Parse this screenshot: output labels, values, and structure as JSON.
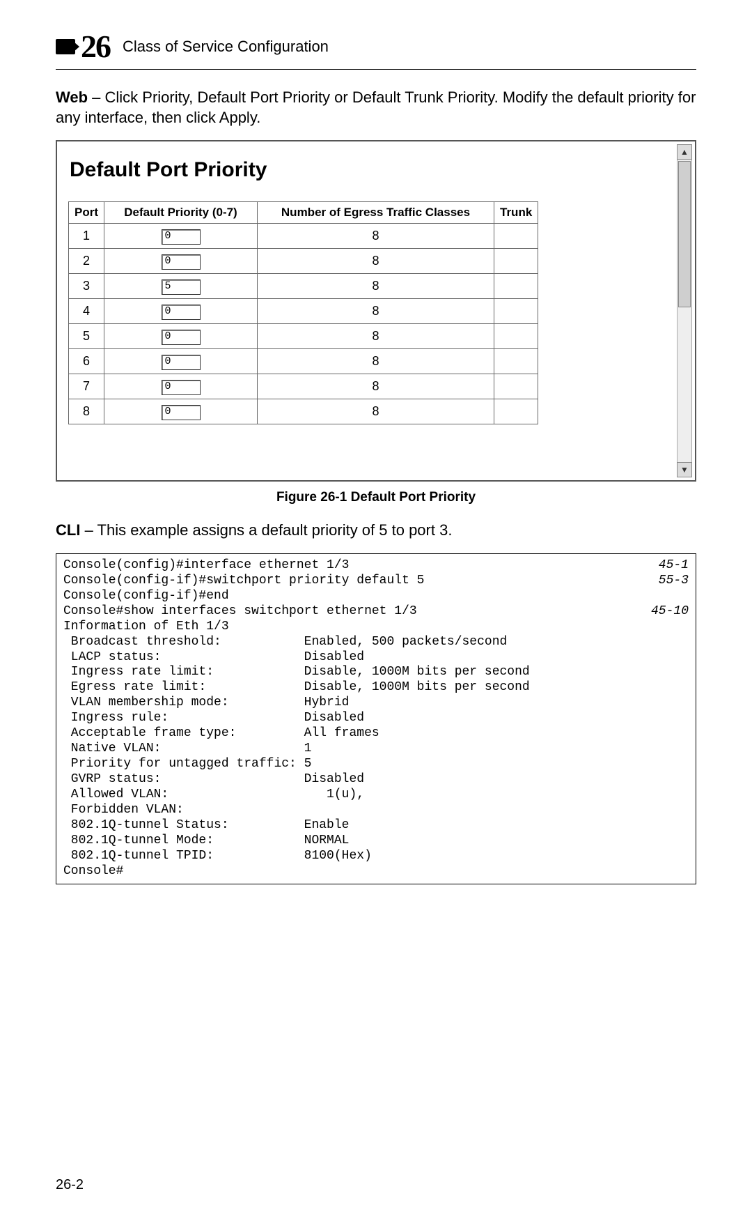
{
  "chapter": {
    "number": "26",
    "title": "Class of Service Configuration"
  },
  "intro": {
    "prefix": "Web",
    "text": " – Click Priority, Default Port Priority or Default Trunk Priority. Modify the default priority for any interface, then click Apply."
  },
  "panel": {
    "title": "Default Port Priority",
    "columns": [
      "Port",
      "Default Priority (0-7)",
      "Number of Egress Traffic Classes",
      "Trunk"
    ],
    "rows": [
      {
        "port": "1",
        "prio": "0",
        "classes": "8",
        "trunk": ""
      },
      {
        "port": "2",
        "prio": "0",
        "classes": "8",
        "trunk": ""
      },
      {
        "port": "3",
        "prio": "5",
        "classes": "8",
        "trunk": ""
      },
      {
        "port": "4",
        "prio": "0",
        "classes": "8",
        "trunk": ""
      },
      {
        "port": "5",
        "prio": "0",
        "classes": "8",
        "trunk": ""
      },
      {
        "port": "6",
        "prio": "0",
        "classes": "8",
        "trunk": ""
      },
      {
        "port": "7",
        "prio": "0",
        "classes": "8",
        "trunk": ""
      },
      {
        "port": "8",
        "prio": "0",
        "classes": "8",
        "trunk": ""
      }
    ]
  },
  "figure_caption": "Figure 26-1  Default Port Priority",
  "cli_intro": {
    "prefix": "CLI",
    "text": " – This example assigns a default priority of 5 to port 3."
  },
  "cli": {
    "lines": [
      {
        "t": "Console(config)#interface ethernet 1/3",
        "ref": "45-1"
      },
      {
        "t": "Console(config-if)#switchport priority default 5",
        "ref": "55-3"
      },
      {
        "t": "Console(config-if)#end",
        "ref": ""
      },
      {
        "t": "Console#show interfaces switchport ethernet 1/3",
        "ref": "45-10"
      },
      {
        "t": "Information of Eth 1/3",
        "ref": ""
      },
      {
        "t": " Broadcast threshold:           Enabled, 500 packets/second",
        "ref": ""
      },
      {
        "t": " LACP status:                   Disabled",
        "ref": ""
      },
      {
        "t": " Ingress rate limit:            Disable, 1000M bits per second",
        "ref": ""
      },
      {
        "t": " Egress rate limit:             Disable, 1000M bits per second",
        "ref": ""
      },
      {
        "t": " VLAN membership mode:          Hybrid",
        "ref": ""
      },
      {
        "t": " Ingress rule:                  Disabled",
        "ref": ""
      },
      {
        "t": " Acceptable frame type:         All frames",
        "ref": ""
      },
      {
        "t": " Native VLAN:                   1",
        "ref": ""
      },
      {
        "t": " Priority for untagged traffic: 5",
        "ref": ""
      },
      {
        "t": " GVRP status:                   Disabled",
        "ref": ""
      },
      {
        "t": " Allowed VLAN:                     1(u),",
        "ref": ""
      },
      {
        "t": " Forbidden VLAN:",
        "ref": ""
      },
      {
        "t": " 802.1Q-tunnel Status:          Enable",
        "ref": ""
      },
      {
        "t": " 802.1Q-tunnel Mode:            NORMAL",
        "ref": ""
      },
      {
        "t": " 802.1Q-tunnel TPID:            8100(Hex)",
        "ref": ""
      },
      {
        "t": "Console#",
        "ref": ""
      }
    ]
  },
  "page_number": "26-2"
}
